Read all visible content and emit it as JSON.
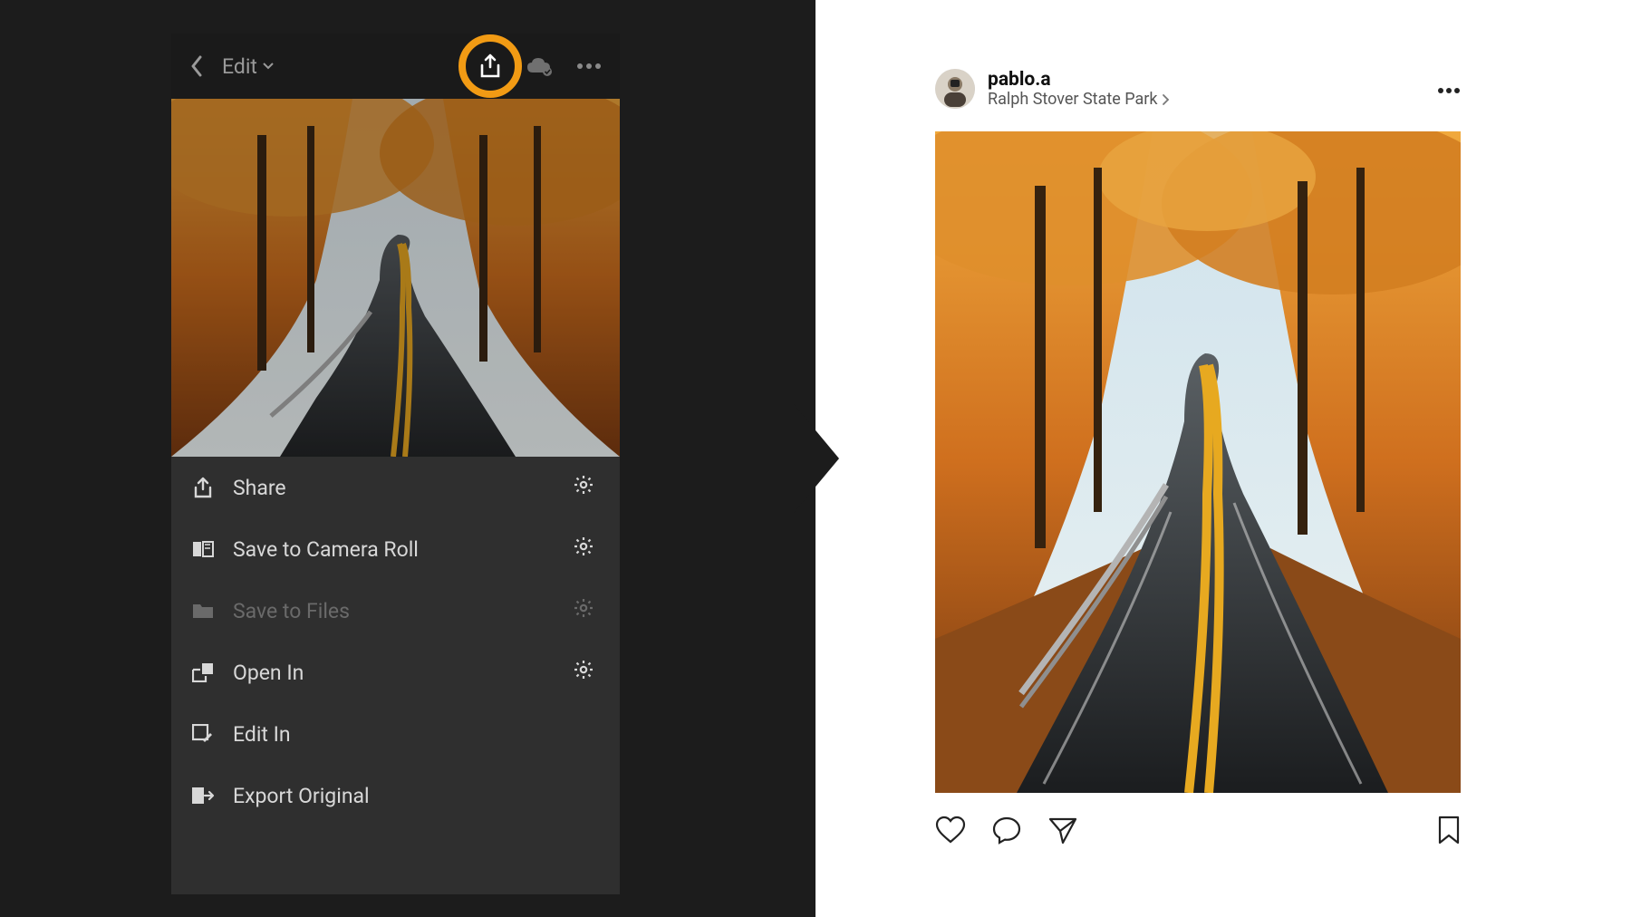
{
  "app": {
    "topbar": {
      "edit_label": "Edit"
    },
    "menu": [
      {
        "id": "share",
        "label": "Share",
        "gear": true,
        "enabled": true,
        "icon": "share-up-icon"
      },
      {
        "id": "save-camera-roll",
        "label": "Save to Camera Roll",
        "gear": true,
        "enabled": true,
        "icon": "camera-roll-icon"
      },
      {
        "id": "save-files",
        "label": "Save to Files",
        "gear": true,
        "enabled": false,
        "icon": "folder-icon"
      },
      {
        "id": "open-in",
        "label": "Open In",
        "gear": true,
        "enabled": true,
        "icon": "open-in-icon"
      },
      {
        "id": "edit-in",
        "label": "Edit In",
        "gear": false,
        "enabled": true,
        "icon": "edit-in-icon"
      },
      {
        "id": "export-original",
        "label": "Export Original",
        "gear": false,
        "enabled": true,
        "icon": "export-icon"
      }
    ]
  },
  "post": {
    "username": "pablo.a",
    "location": "Ralph Stover State Park"
  },
  "colors": {
    "highlight": "#f29b14",
    "dark_bg": "#1c1c1c",
    "panel_bg": "#2f2f2f"
  }
}
